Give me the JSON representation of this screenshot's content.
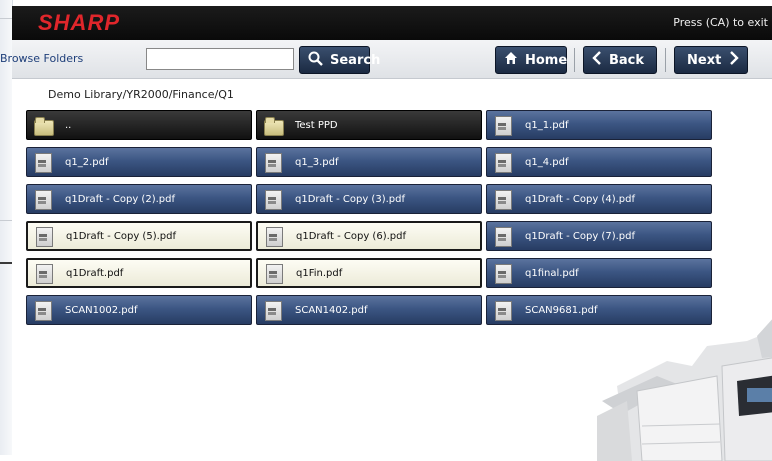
{
  "brand": "SHARP",
  "titlebar_message": "Press (CA) to exit",
  "toolbar": {
    "browse_label": "Browse Folders",
    "search_value": "",
    "search_label": "Search",
    "home_label": "Home",
    "back_label": "Back",
    "next_label": "Next"
  },
  "path": "Demo Library/YR2000/Finance/Q1",
  "items": [
    {
      "label": "..",
      "type": "folder",
      "style": "dark"
    },
    {
      "label": "Test PPD",
      "type": "folder",
      "style": "dark"
    },
    {
      "label": "q1_1.pdf",
      "type": "doc",
      "style": "blue"
    },
    {
      "label": "q1_2.pdf",
      "type": "doc",
      "style": "blue"
    },
    {
      "label": "q1_3.pdf",
      "type": "doc",
      "style": "blue"
    },
    {
      "label": "q1_4.pdf",
      "type": "doc",
      "style": "blue"
    },
    {
      "label": "q1Draft - Copy (2).pdf",
      "type": "doc",
      "style": "blue"
    },
    {
      "label": "q1Draft - Copy (3).pdf",
      "type": "doc",
      "style": "blue"
    },
    {
      "label": "q1Draft - Copy (4).pdf",
      "type": "doc",
      "style": "blue"
    },
    {
      "label": "q1Draft - Copy (5).pdf",
      "type": "doc",
      "style": "light"
    },
    {
      "label": "q1Draft - Copy (6).pdf",
      "type": "doc",
      "style": "light"
    },
    {
      "label": "q1Draft - Copy (7).pdf",
      "type": "doc",
      "style": "blue"
    },
    {
      "label": "q1Draft.pdf",
      "type": "doc",
      "style": "light"
    },
    {
      "label": "q1Fin.pdf",
      "type": "doc",
      "style": "light"
    },
    {
      "label": "q1final.pdf",
      "type": "doc",
      "style": "blue"
    },
    {
      "label": "SCAN1002.pdf",
      "type": "doc",
      "style": "blue"
    },
    {
      "label": "SCAN1402.pdf",
      "type": "doc",
      "style": "blue"
    },
    {
      "label": "SCAN9681.pdf",
      "type": "doc",
      "style": "blue"
    }
  ],
  "colors": {
    "brand_red": "#e0262b",
    "button_navy": "#1b2a42",
    "item_blue": "#3c5683",
    "item_selected": "#f4f2e2"
  },
  "icons": {
    "search": "magnifier-icon",
    "home": "house-icon",
    "back": "chevron-left-icon",
    "next": "chevron-right-icon",
    "folder": "folder-icon",
    "document": "document-icon"
  }
}
